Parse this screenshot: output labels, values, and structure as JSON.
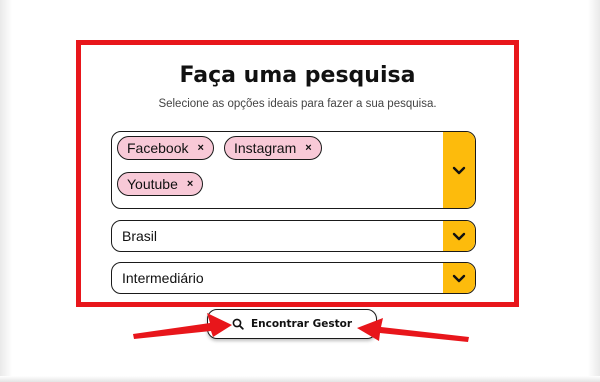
{
  "form": {
    "title": "Faça uma pesquisa",
    "subtitle": "Selecione as opções ideais para fazer a sua pesquisa.",
    "platforms": {
      "selected": [
        {
          "label": "Facebook",
          "remove": "×"
        },
        {
          "label": "Instagram",
          "remove": "×"
        },
        {
          "label": "Youtube",
          "remove": "×"
        }
      ],
      "icon": "chevron-down-icon"
    },
    "country": {
      "value": "Brasil",
      "icon": "chevron-down-icon"
    },
    "level": {
      "value": "Intermediário",
      "icon": "chevron-down-icon"
    },
    "search_button": {
      "label": "Encontrar Gestor",
      "icon": "search-icon"
    }
  },
  "colors": {
    "highlight_border": "#e8161b",
    "dropdown_accent": "#fdbb0c",
    "tag_fill": "#f8c9d7",
    "arrow": "#e8161b"
  }
}
